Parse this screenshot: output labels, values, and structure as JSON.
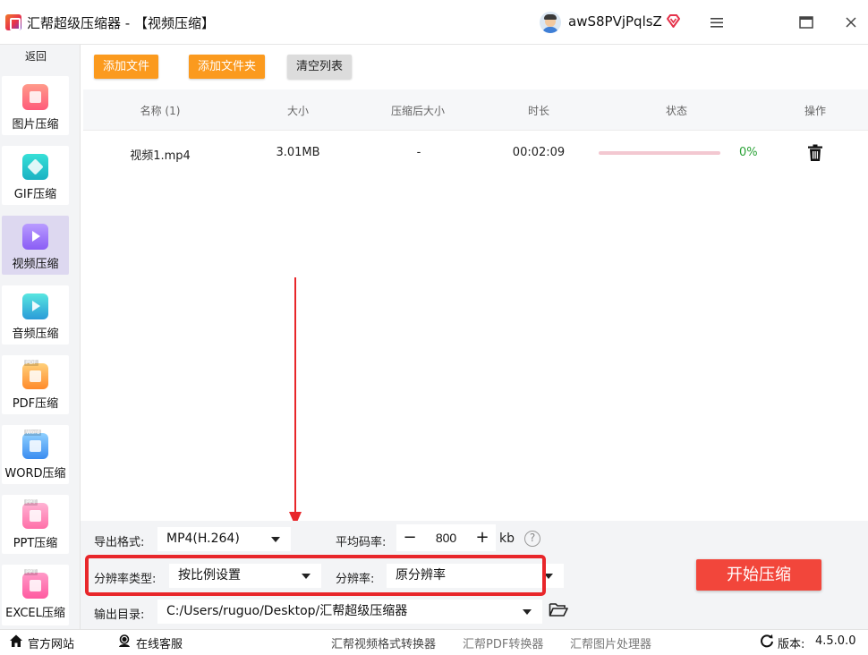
{
  "app": {
    "title": "汇帮超级压缩器 - 【视频压缩】",
    "username": "awS8PVjPqlsZ"
  },
  "sidebar": {
    "back_label": "返回",
    "items": [
      {
        "label": "图片压缩",
        "icon": "image-icon"
      },
      {
        "label": "GIF压缩",
        "icon": "gif-icon"
      },
      {
        "label": "视频压缩",
        "icon": "video-icon",
        "active": true
      },
      {
        "label": "音频压缩",
        "icon": "audio-icon"
      },
      {
        "label": "PDF压缩",
        "icon": "pdf-icon",
        "tag": "PDF"
      },
      {
        "label": "WORD压缩",
        "icon": "word-icon",
        "tag": "Word"
      },
      {
        "label": "PPT压缩",
        "icon": "ppt-icon",
        "tag": "PPT"
      },
      {
        "label": "EXCEL压缩",
        "icon": "excel-icon",
        "tag": "PPT"
      }
    ]
  },
  "toolbar": {
    "add_file": "添加文件",
    "add_folder": "添加文件夹",
    "clear_list": "清空列表"
  },
  "table": {
    "headers": {
      "name": "名称 (1)",
      "size": "大小",
      "compressed_size": "压缩后大小",
      "duration": "时长",
      "status": "状态",
      "action": "操作"
    },
    "rows": [
      {
        "name": "视频1.mp4",
        "size": "3.01MB",
        "compressed_size": "-",
        "duration": "00:02:09",
        "progress": 0,
        "progress_text": "0%"
      }
    ]
  },
  "settings": {
    "format_label": "导出格式:",
    "format_value": "MP4(H.264)",
    "bitrate_label": "平均码率:",
    "bitrate_value": "800",
    "bitrate_unit": "kb",
    "resolution_type_label": "分辨率类型:",
    "resolution_type_value": "按比例设置",
    "resolution_label": "分辨率:",
    "resolution_value": "原分辨率",
    "output_label": "输出目录:",
    "output_path": "C:/Users/ruguo/Desktop/汇帮超级压缩器",
    "start_button": "开始压缩"
  },
  "bottombar": {
    "website": "官方网站",
    "support": "在线客服",
    "link1": "汇帮视频格式转换器",
    "link2": "汇帮PDF转换器",
    "link3": "汇帮图片处理器",
    "version_label": "版本:",
    "version_value": "4.5.0.0"
  },
  "colors": {
    "accent_orange": "#fb9a1e",
    "start_red": "#f2463b",
    "annotation_red": "#e8262a",
    "progress_green": "#2aa236"
  }
}
